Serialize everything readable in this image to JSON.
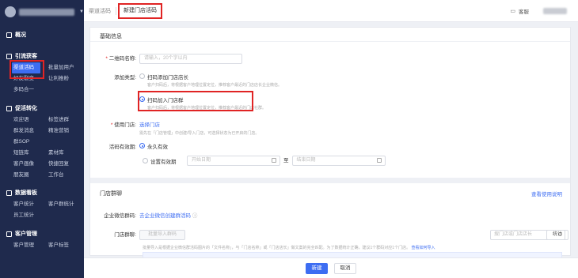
{
  "sidebar": {
    "sections": [
      {
        "title": "概况",
        "items": []
      },
      {
        "title": "引流获客",
        "items": [
          "渠道活码",
          "批量加用户",
          "好友裂变",
          "让利推粉",
          "多码合一"
        ]
      },
      {
        "title": "促活转化",
        "items": [
          "欢迎语",
          "标签进群",
          "群发消息",
          "精准营销",
          "群SOP",
          "短链库",
          "素材库",
          "客户画像",
          "快捷回复",
          "朋友圈",
          "工作台"
        ]
      },
      {
        "title": "数据看板",
        "items": [
          "客户统计",
          "客户群统计",
          "员工统计"
        ]
      },
      {
        "title": "客户管理",
        "items": [
          "客户管理",
          "客户标签"
        ]
      }
    ]
  },
  "topbar": {
    "tabs": [
      "渠道活码",
      "新建门店活码"
    ],
    "service": "客服"
  },
  "form": {
    "section_basic": "基础信息",
    "qr_name_label": "二维码名称:",
    "qr_name_placeholder": "请输入，20个字以内",
    "add_type_label": "添加类型:",
    "opt1_title": "扫码添加门店店长",
    "opt1_desc": "客户扫码后，将根据客户地理位置定位，推荐客户最近的门店店长企业微信。",
    "opt2_title": "扫码加入门店群",
    "opt2_desc": "客户扫码后，将根据客户地理位置定位，推荐客户最近的门店社群。",
    "store_label": "使用门店:",
    "store_link": "选择门店",
    "store_hint": "需先在「门店管理」中创建/导入门店，可选择状态为已开启的门店。",
    "validity_label": "活码有效期:",
    "validity_opt1": "永久有效",
    "validity_opt2": "设置有效期",
    "start_date": "开始日期",
    "end_date": "结束日期",
    "to": "至",
    "section_group": "门店群聊",
    "view_help": "查看使用说明",
    "wx_qr_label": "企业微信群码:",
    "wx_qr_link": "去企业微信创建群活码",
    "group_label": "门店群聊:",
    "batch_import": "批量导入群码",
    "search_placeholder": "搜门店或门店店长",
    "stats": "统计",
    "import_hint": "批量导入是根据企业微信群活码图片的「文件名称」，与「门店名称」或「门店店长」做文案的完全匹配。为了数据统计正确，建议1个群码对应1个门店。",
    "import_hint_link": "查看如何导入"
  },
  "footer": {
    "create": "新建",
    "cancel": "取消"
  },
  "colors": {
    "accent": "#3d6df2",
    "sidebar_bg": "#1f2a4d",
    "highlight": "#e02424"
  }
}
